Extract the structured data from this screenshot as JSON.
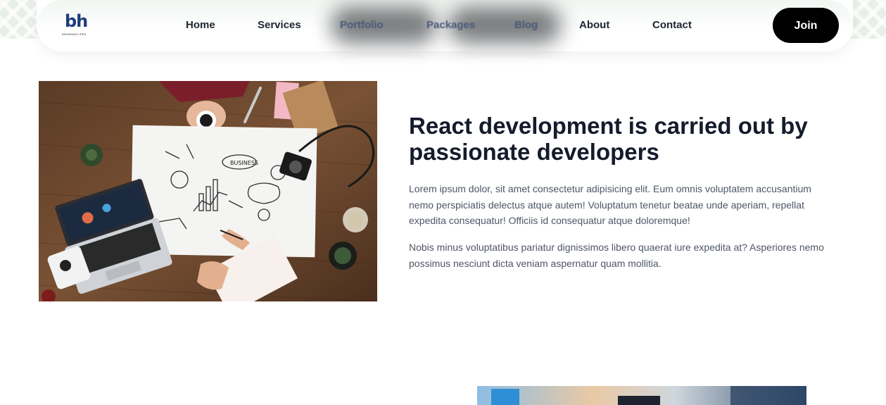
{
  "nav": {
    "logo_mark": "bh",
    "logo_sub_a": "BRANDING",
    "logo_sub_b": "H",
    "logo_sub_c": "PES",
    "links": [
      "Home",
      "Services",
      "Portfolio",
      "Packages",
      "Blog",
      "About",
      "Contact"
    ],
    "join_label": "Join"
  },
  "hero": {
    "headline": "React development is carried out by passionate developers",
    "paragraph_1": "Lorem ipsum dolor, sit amet consectetur adipisicing elit. Eum omnis voluptatem accusantium nemo perspiciatis delectus atque autem! Voluptatum tenetur beatae unde aperiam, repellat expedita consequatur! Officiis id consequatur atque doloremque!",
    "paragraph_2": "Nobis minus voluptatibus pariatur dignissimos libero quaerat iure expedita at? Asperiores nemo possimus nesciunt dicta veniam aspernatur quam mollitia.",
    "image_sign_text": "BUSINESS"
  },
  "colors": {
    "join_bg": "#000000",
    "headline": "#141b2b",
    "body_text": "#4e5666"
  }
}
